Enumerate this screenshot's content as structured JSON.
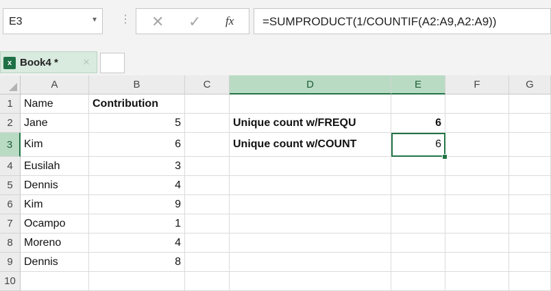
{
  "formula_bar": {
    "name_box": "E3",
    "dropdown_icon": "▾",
    "separator": "⋮",
    "cancel_glyph": "✕",
    "enter_glyph": "✓",
    "fx_label": "fx",
    "formula": "=SUMPRODUCT(1/COUNTIF(A2:A9,A2:A9))"
  },
  "workbook_tab": {
    "title": "Book4 *",
    "close_glyph": "×",
    "icon_text": "x"
  },
  "columns": [
    "A",
    "B",
    "C",
    "D",
    "E",
    "F",
    "G"
  ],
  "rows": [
    "1",
    "2",
    "3",
    "4",
    "5",
    "6",
    "7",
    "8",
    "9",
    "10"
  ],
  "cells": {
    "A1": "Name",
    "B1": "Contribution",
    "A2": "Jane",
    "B2": "5",
    "D2": "Unique count w/FREQU",
    "E2": "6",
    "A3": "Kim",
    "B3": "6",
    "D3": "Unique count w/COUNT",
    "E3": "6",
    "A4": "Eusilah",
    "B4": "3",
    "A5": "Dennis",
    "B5": "4",
    "A6": "Kim",
    "B6": "9",
    "A7": "Ocampo",
    "B7": "1",
    "A8": "Moreno",
    "B8": "4",
    "A9": "Dennis",
    "B9": "8"
  },
  "colors": {
    "accent": "#217346",
    "selected_header": "#b9dbc4"
  }
}
